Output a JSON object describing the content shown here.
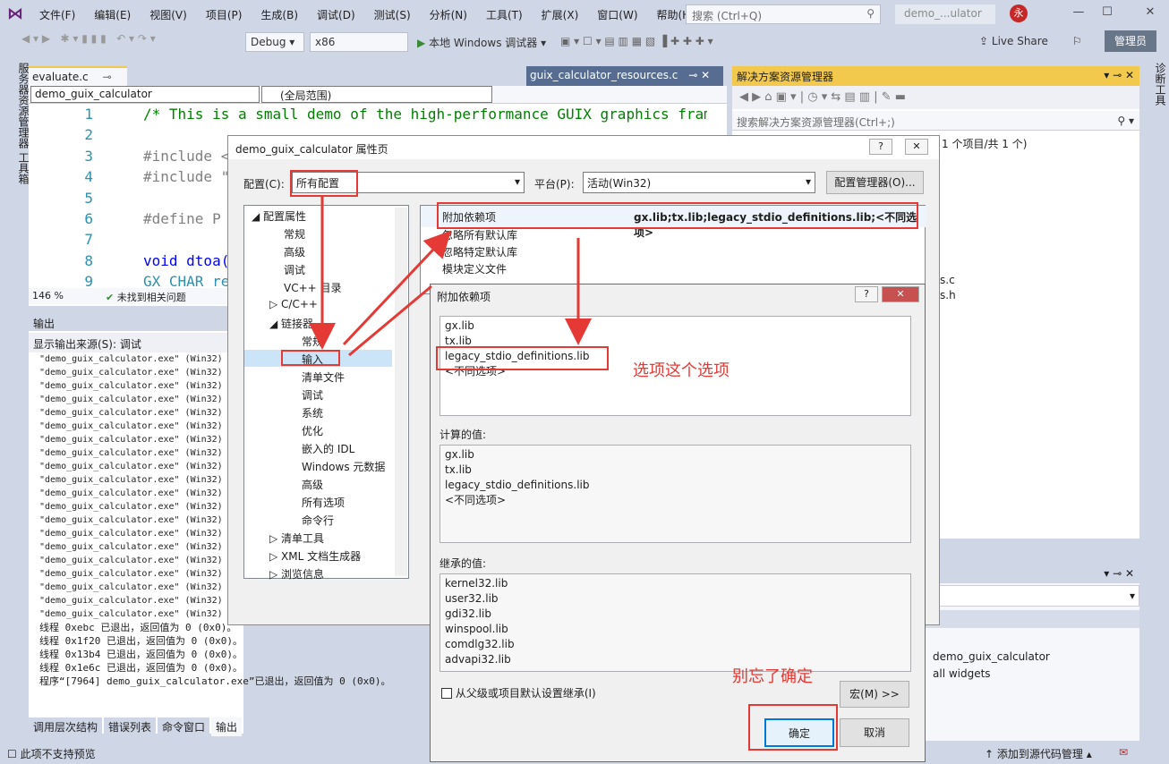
{
  "menubar": {
    "items": [
      "文件(F)",
      "编辑(E)",
      "视图(V)",
      "项目(P)",
      "生成(B)",
      "调试(D)",
      "测试(S)",
      "分析(N)",
      "工具(T)",
      "扩展(X)",
      "窗口(W)",
      "帮助(H)"
    ],
    "search_placeholder": "搜索 (Ctrl+Q)",
    "title": "demo_...ulator",
    "avatar": "永"
  },
  "toolbar": {
    "config": "Debug",
    "platform": "x86",
    "run": "本地 Windows 调试器",
    "live_share": "Live Share",
    "admin": "管理员"
  },
  "side": {
    "left": "服务器资源管理器 工具箱",
    "right": "诊断工具"
  },
  "editor": {
    "tab": "evaluate.c",
    "tab2": "guix_calculator_resources.c",
    "nav_project": "demo_guix_calculator",
    "nav_scope": "(全局范围)",
    "zoom": "146 %",
    "issues": "未找到相关问题",
    "lines": [
      {
        "n": "1",
        "t": "/* This is a small demo of the high-performance GUIX graphics frame"
      },
      {
        "n": "2",
        "t": ""
      },
      {
        "n": "3",
        "t": "#include <"
      },
      {
        "n": "4",
        "t": "#include \""
      },
      {
        "n": "5",
        "t": ""
      },
      {
        "n": "6",
        "t": "#define  P"
      },
      {
        "n": "7",
        "t": ""
      },
      {
        "n": "8",
        "t": "void dtoa("
      },
      {
        "n": "9",
        "t": "GX_CHAR re"
      }
    ]
  },
  "output": {
    "title": "输出",
    "source_label": "显示输出来源(S):",
    "source": "调试",
    "repeat_line": "\"demo_guix_calculator.exe\" (Win32)",
    "tail": [
      "线程 0xebc 已退出，返回值为 0 (0x0)。",
      "线程 0x1f20 已退出，返回值为 0 (0x0)。",
      "线程 0x13b4 已退出，返回值为 0 (0x0)。",
      "线程 0x1e6c 已退出，返回值为 0 (0x0)。",
      "程序“[7964] demo_guix_calculator.exe”已退出，返回值为 0 (0x0)。"
    ],
    "tabs": [
      "调用层次结构",
      "错误列表",
      "命令窗口",
      "输出"
    ]
  },
  "status": {
    "left": "此项不支持预览",
    "right": "添加到源代码管理"
  },
  "solution": {
    "title": "解决方案资源管理器",
    "search": "搜索解决方案资源管理器(Ctrl+;)",
    "count": "1 个项目/共 1 个)",
    "props1": "demo_guix_calculator",
    "props2": "all widgets"
  },
  "dialog": {
    "title": "demo_guix_calculator 属性页",
    "config_label": "配置(C):",
    "config_value": "所有配置",
    "platform_label": "平台(P):",
    "platform_value": "活动(Win32)",
    "config_manager": "配置管理器(O)...",
    "tree": [
      "配置属性",
      "常规",
      "高级",
      "调试",
      "VC++ 目录",
      "C/C++",
      "链接器",
      "常规",
      "输入",
      "清单文件",
      "调试",
      "系统",
      "优化",
      "嵌入的 IDL",
      "Windows 元数据",
      "高级",
      "所有选项",
      "命令行",
      "清单工具",
      "XML 文档生成器",
      "浏览信息"
    ],
    "grid": [
      {
        "k": "附加依赖项",
        "v": "gx.lib;tx.lib;legacy_stdio_definitions.lib;<不同选项>"
      },
      {
        "k": "忽略所有默认库",
        "v": ""
      },
      {
        "k": "忽略特定默认库",
        "v": ""
      },
      {
        "k": "模块定义文件",
        "v": ""
      }
    ]
  },
  "dialog2": {
    "title": "附加依赖项",
    "entries": [
      "gx.lib",
      "tx.lib",
      "legacy_stdio_definitions.lib",
      "<不同选项>"
    ],
    "computed_label": "计算的值:",
    "computed": [
      "gx.lib",
      "tx.lib",
      "legacy_stdio_definitions.lib",
      "<不同选项>"
    ],
    "inherited_label": "继承的值:",
    "inherited": [
      "kernel32.lib",
      "user32.lib",
      "gdi32.lib",
      "winspool.lib",
      "comdlg32.lib",
      "advapi32.lib"
    ],
    "inherit_checkbox": "从父级或项目默认设置继承(I)",
    "macro": "宏(M) >>",
    "ok": "确定",
    "cancel": "取消"
  },
  "annotations": {
    "note1": "选项这个选项",
    "note2": "别忘了确定"
  }
}
